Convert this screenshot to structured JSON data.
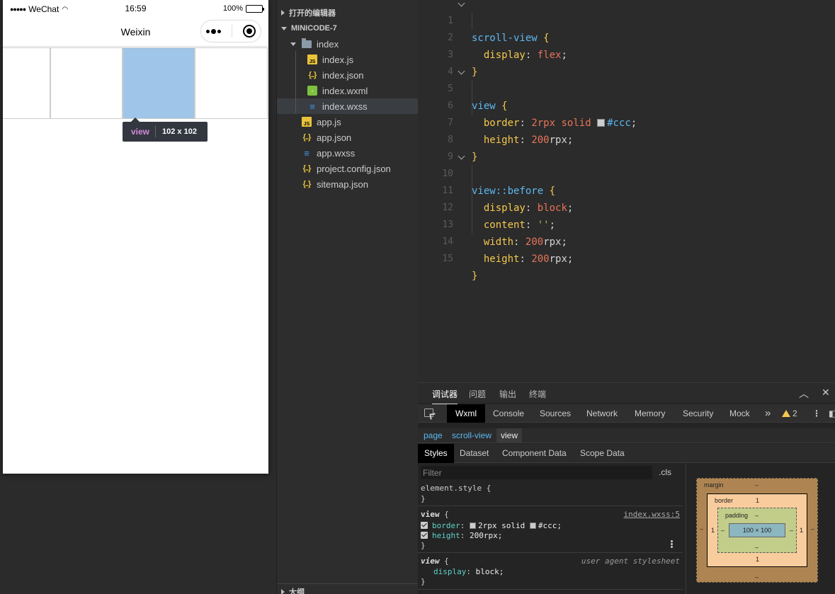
{
  "simulator": {
    "status_bar": {
      "carrier": "WeChat",
      "time": "16:59",
      "battery": "100%",
      "battery_level": 1.0
    },
    "nav_bar": {
      "title": "Weixin"
    },
    "tooltip": {
      "tag": "view",
      "size": "102 x 102"
    }
  },
  "explorer": {
    "open_editors_label": "打开的编辑器",
    "project_label": "MINICODE-7",
    "folder": "index",
    "folder_files": [
      "index.js",
      "index.json",
      "index.wxml",
      "index.wxss"
    ],
    "root_files": [
      "app.js",
      "app.json",
      "app.wxss",
      "project.config.json",
      "sitemap.json"
    ],
    "selected_file": "index.wxss",
    "outline_label": "大纲"
  },
  "editor": {
    "line_numbers": [
      "1",
      "2",
      "3",
      "4",
      "5",
      "6",
      "7",
      "8",
      "9",
      "10",
      "11",
      "12",
      "13",
      "14",
      "15"
    ],
    "colors": {
      "selector": "#5cb8f0",
      "property": "#f5c94d",
      "value": "#e8745a",
      "string": "#9cc26b"
    },
    "tokens": {
      "sel1": "scroll-view",
      "ob": "{",
      "cb": "}",
      "p_display": "display",
      "v_flex": "flex",
      "sel2": "view",
      "p_border": "border",
      "v_border_num": "2",
      "v_border_unit": "rpx",
      "v_solid": "solid",
      "v_ccc": "#ccc",
      "p_height": "height",
      "v_200": "200",
      "u_rpx": "rpx",
      "sel3": "view::before",
      "v_block": "block",
      "p_content": "content",
      "v_empty": "''",
      "p_width": "width",
      "colon": ":",
      "semi": ";"
    }
  },
  "panel": {
    "tabs": [
      "调试器",
      "问题",
      "输出",
      "终端"
    ],
    "devtools_tabs": [
      "Wxml",
      "Console",
      "Sources",
      "Network",
      "Memory",
      "Security",
      "Mock"
    ],
    "more": "»",
    "warnings": "2",
    "crumbs": [
      "page",
      "scroll-view",
      "view"
    ],
    "sub_tabs": [
      "Styles",
      "Dataset",
      "Component Data",
      "Scope Data"
    ],
    "filter_placeholder": "Filter",
    "cls": ".cls",
    "element_style": "element.style {",
    "close_brace": "}",
    "rule1": {
      "selector": "view",
      "brace": " {",
      "source": "index.wxss:5",
      "p1": "border",
      "v1": "2rpx solid",
      "v1c": "#ccc;",
      "p2": "height",
      "v2": "200rpx;"
    },
    "rule2": {
      "selector": "view",
      "brace": " {",
      "source": "user agent stylesheet",
      "p1": "display",
      "v1": "block;"
    },
    "boxmodel": {
      "margin": "margin",
      "border": "border",
      "padding": "padding",
      "content": "100 × 100",
      "dash": "–",
      "one": "1"
    }
  }
}
